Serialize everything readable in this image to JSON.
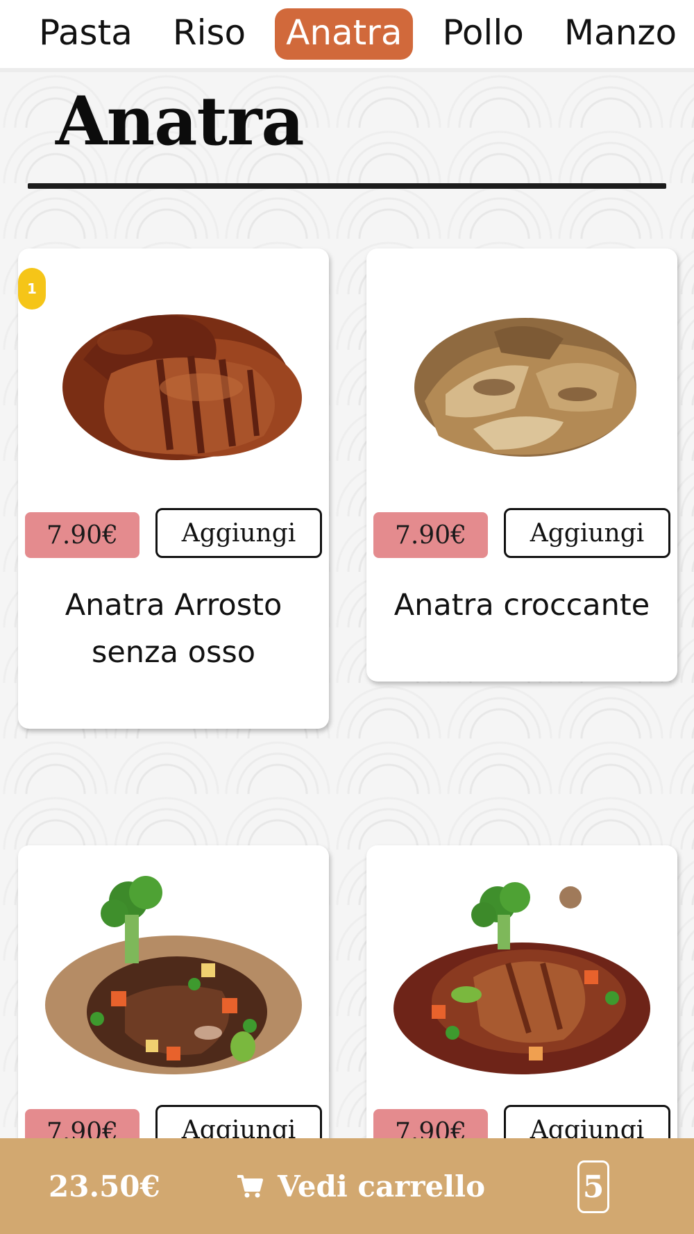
{
  "nav": {
    "tabs": [
      {
        "label": "Pasta"
      },
      {
        "label": "Riso"
      },
      {
        "label": "Anatra",
        "active": true
      },
      {
        "label": "Pollo"
      },
      {
        "label": "Manzo"
      }
    ],
    "active_color": "#d1693b"
  },
  "section": {
    "title": "Anatra"
  },
  "products": [
    {
      "name": "Anatra Arrosto senza osso",
      "price": "7.90€",
      "add_label": "Aggiungi",
      "quantity": "1",
      "image": "roast-duck-image"
    },
    {
      "name": "Anatra croccante",
      "price": "7.90€",
      "add_label": "Aggiungi",
      "image": "crispy-duck-image"
    },
    {
      "name": "",
      "price": "7.90€",
      "add_label": "Aggiungi",
      "image": "duck-vegetables-image"
    },
    {
      "name": "",
      "price": "7.90€",
      "add_label": "Aggiungi",
      "image": "duck-sauce-image"
    }
  ],
  "cart": {
    "total": "23.50€",
    "view_label": "Vedi carrello",
    "count": "5",
    "icon": "cart-icon",
    "bar_color": "#d2a870"
  },
  "colors": {
    "price_badge": "#e48b8e",
    "quantity_badge": "#f5c518"
  }
}
